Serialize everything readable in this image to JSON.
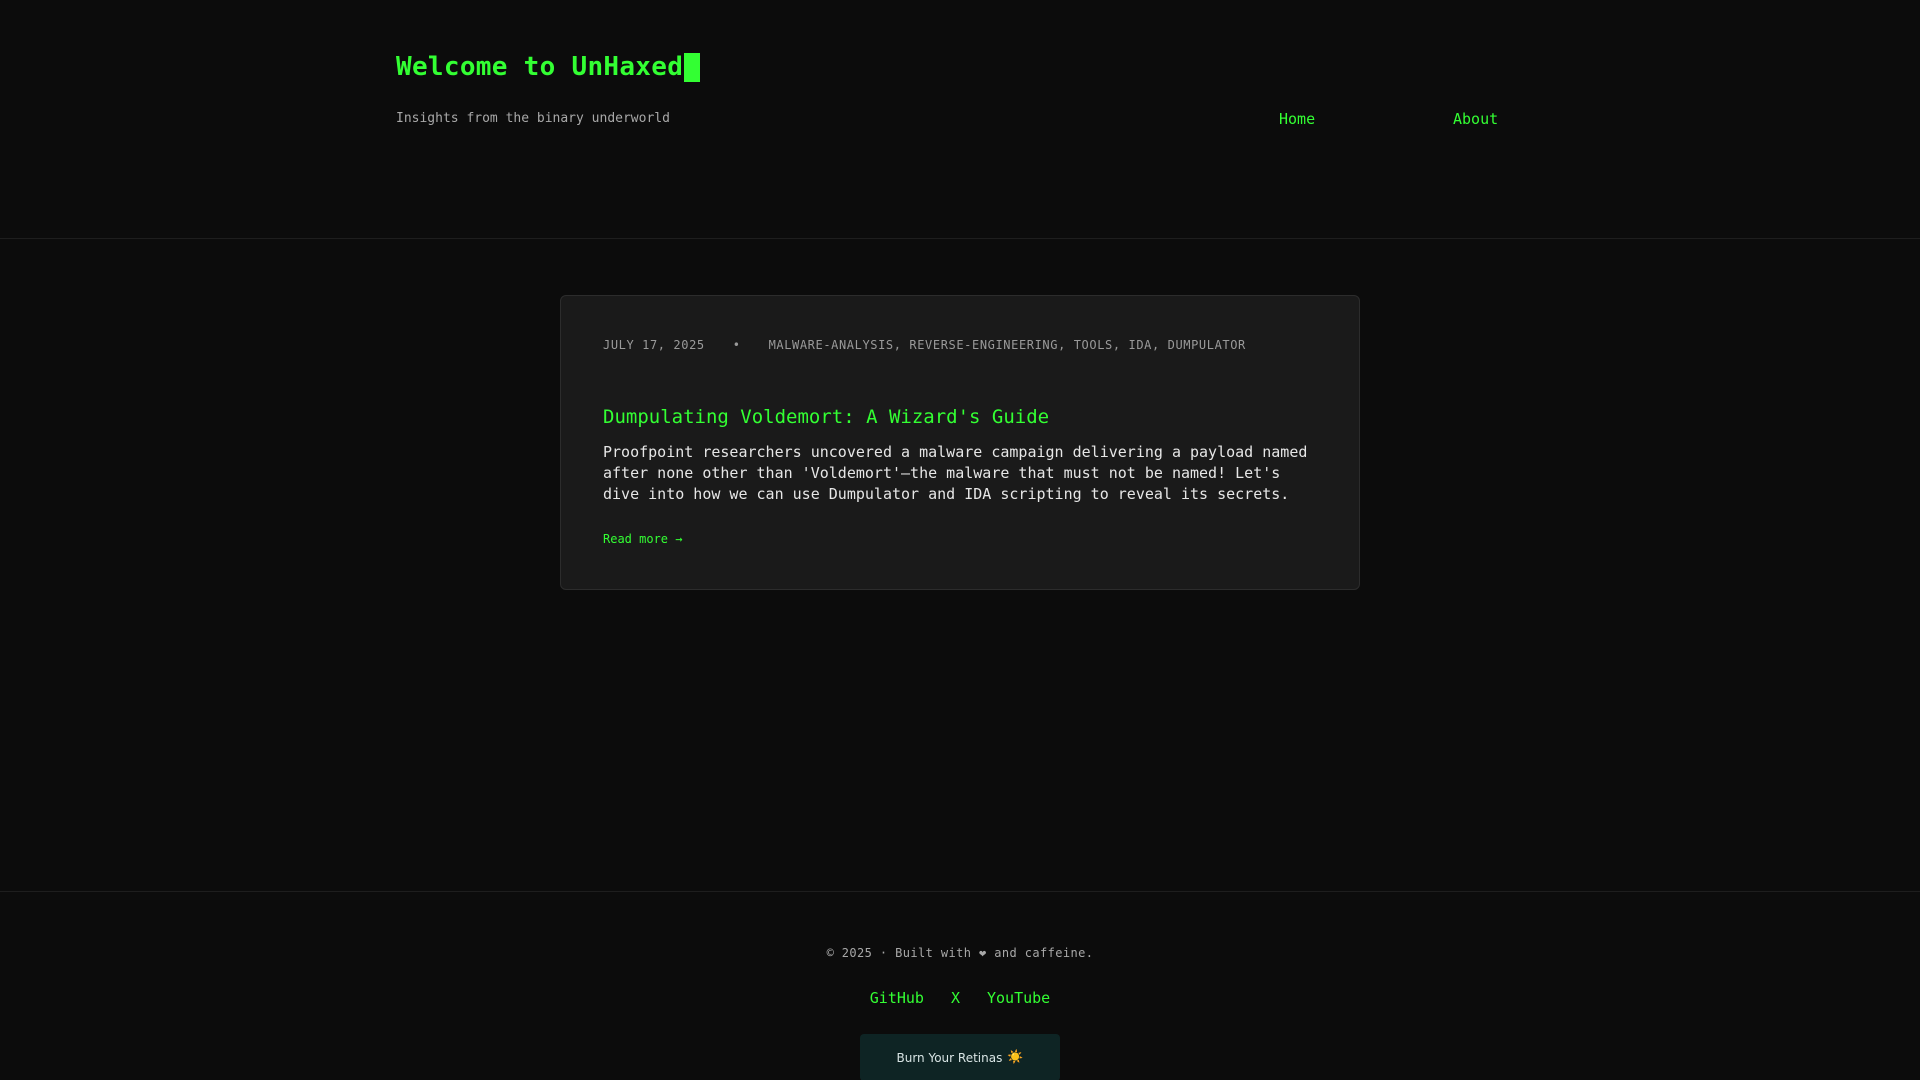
{
  "header": {
    "title": "Welcome to UnHaxed",
    "tagline": "Insights from the binary underworld",
    "nav": [
      {
        "label": "Home"
      },
      {
        "label": "About"
      }
    ]
  },
  "post": {
    "date": "JULY 17, 2025",
    "separator": "•",
    "tags": "MALWARE-ANALYSIS, REVERSE-ENGINEERING, TOOLS, IDA, DUMPULATOR",
    "title": "Dumpulating Voldemort: A Wizard's Guide",
    "excerpt": "Proofpoint researchers uncovered a malware campaign delivering a payload named after none other than 'Voldemort'—the malware that must not be named! Let's dive into how we can use Dumpulator and IDA scripting to reveal its secrets.",
    "read_more": "Read more →"
  },
  "footer": {
    "copyright": "© 2025 · Built with ❤ and caffeine.",
    "links": [
      {
        "label": "GitHub"
      },
      {
        "label": "X"
      },
      {
        "label": "YouTube"
      }
    ],
    "theme_button_label": "Burn Your Retinas",
    "theme_button_icon": "☀️"
  },
  "colors": {
    "background": "#0c0c0c",
    "accent": "#33ff33",
    "card": "#1a1a1a",
    "button": "#0e2424"
  }
}
